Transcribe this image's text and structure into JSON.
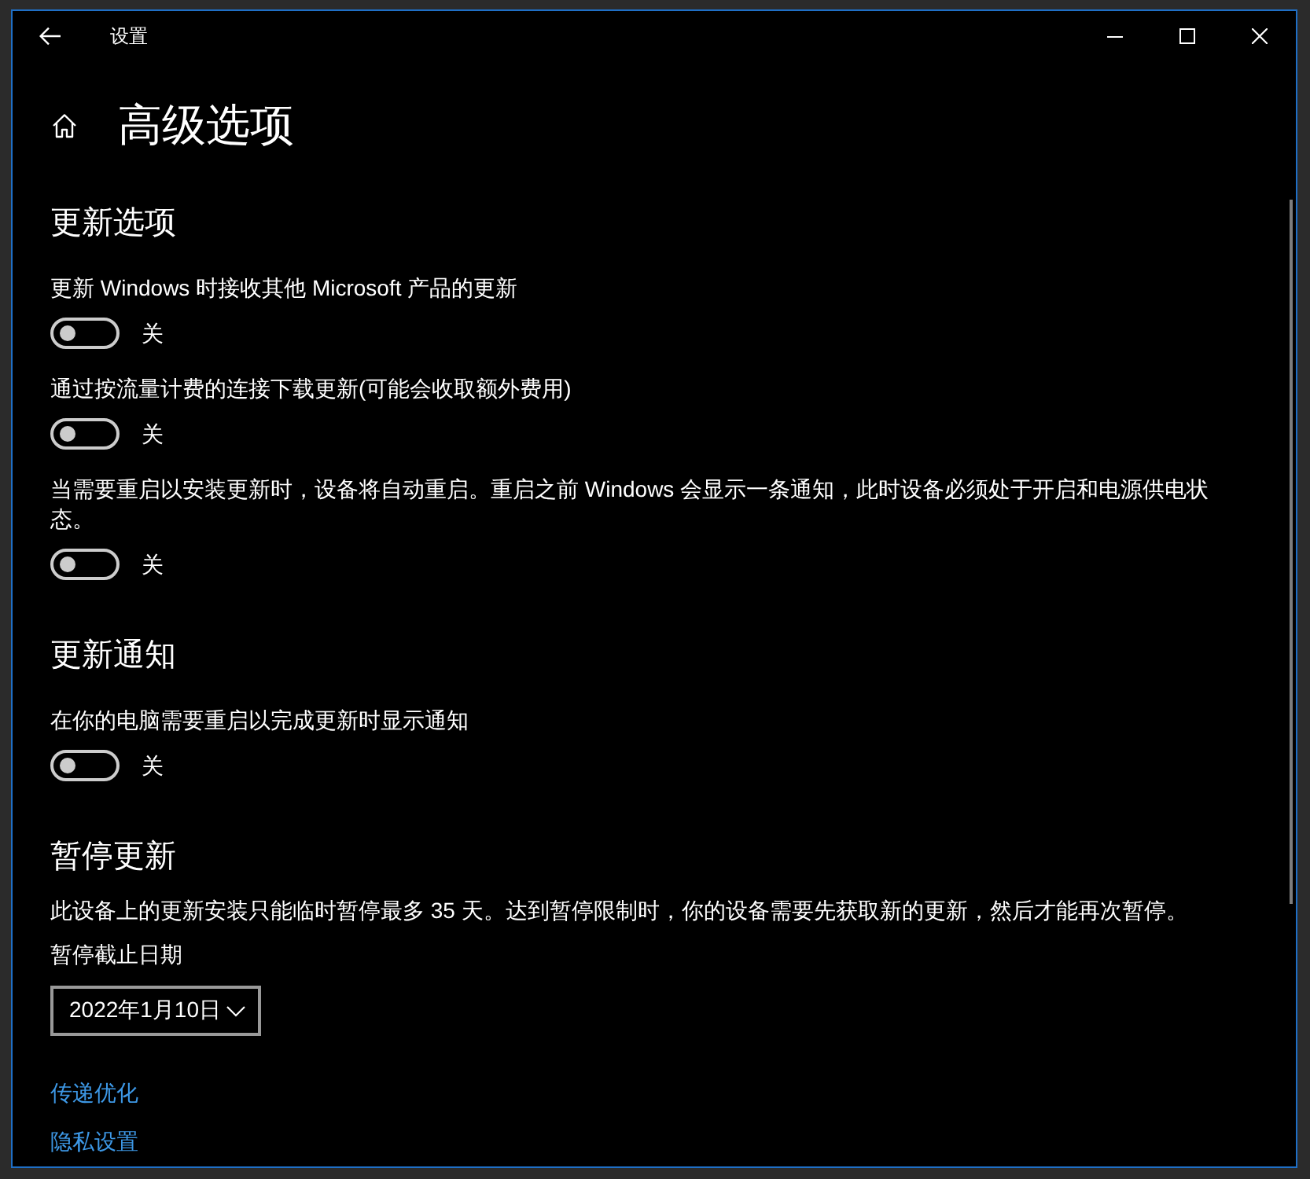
{
  "window": {
    "title": "设置"
  },
  "page": {
    "title": "高级选项"
  },
  "sections": [
    {
      "heading": "更新选项",
      "settings": [
        {
          "kind": "toggle",
          "label": "更新 Windows 时接收其他 Microsoft 产品的更新",
          "on": false,
          "state_label": "关"
        },
        {
          "kind": "toggle",
          "label": "通过按流量计费的连接下载更新(可能会收取额外费用)",
          "on": false,
          "state_label": "关"
        },
        {
          "kind": "toggle",
          "label": "当需要重启以安装更新时，设备将自动重启。重启之前 Windows 会显示一条通知，此时设备必须处于开启和电源供电状态。",
          "on": false,
          "state_label": "关"
        }
      ]
    },
    {
      "heading": "更新通知",
      "settings": [
        {
          "kind": "toggle",
          "label": "在你的电脑需要重启以完成更新时显示通知",
          "on": false,
          "state_label": "关"
        }
      ]
    },
    {
      "heading": "暂停更新",
      "settings": [
        {
          "kind": "text",
          "text": "此设备上的更新安装只能临时暂停最多 35 天。达到暂停限制时，你的设备需要先获取新的更新，然后才能再次暂停。"
        },
        {
          "kind": "date_picker",
          "label": "暂停截止日期",
          "value": "2022年1月10日"
        }
      ]
    }
  ],
  "links": [
    {
      "label": "传递优化"
    },
    {
      "label": "隐私设置"
    }
  ]
}
